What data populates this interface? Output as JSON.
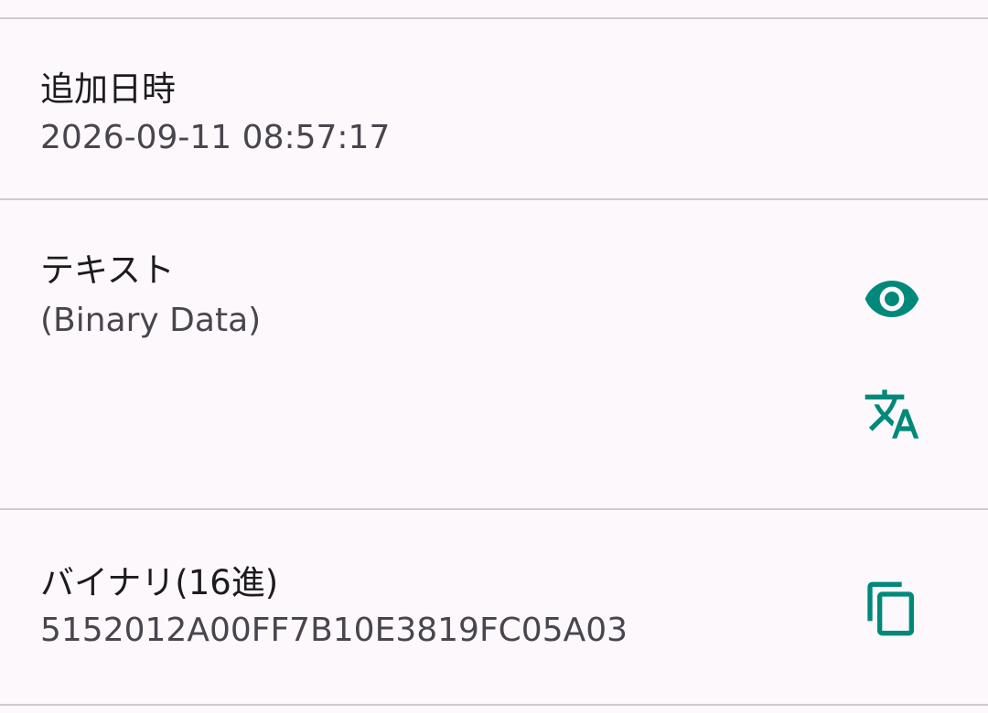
{
  "fields": {
    "added": {
      "label": "追加日時",
      "value": "2026-09-11 08:57:17"
    },
    "text": {
      "label": "テキスト",
      "value": "(Binary Data)",
      "view_icon": "eye-icon",
      "translate_icon": "translate-icon"
    },
    "binary": {
      "label": "バイナリ(16進)",
      "value": "5152012A00FF7B10E3819FC05A03",
      "copy_icon": "copy-icon"
    }
  },
  "colors": {
    "background": "#fdf8fb",
    "accent": "#00897b",
    "divider": "#cfcbcf",
    "primary_text": "#1d1b1e",
    "secondary_text": "#49454e"
  }
}
